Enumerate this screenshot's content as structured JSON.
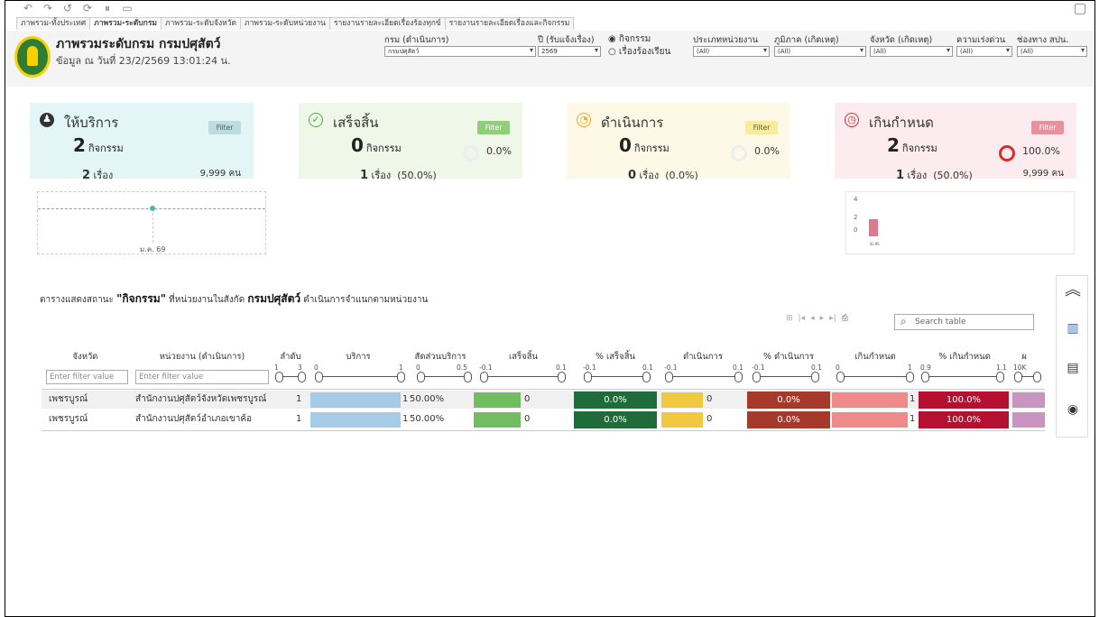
{
  "tabs": [
    "ภาพรวม-ทั้งประเทศ",
    "ภาพรวม-ระดับกรม",
    "ภาพรวม-ระดับจังหวัด",
    "ภาพรวม-ระดับหน่วยงาน",
    "รายงานรายละเอียดเรื่องร้องทุกข์",
    "รายงานรายละเอียดเรื่องและกิจกรรม"
  ],
  "header": {
    "title": "ภาพรวมระดับกรม กรมปศุสัตว์",
    "subtitle": "ข้อมูล ณ วันที่ 23/2/2569 13:01:24 น."
  },
  "filters": {
    "dept": {
      "label": "กรม (ดำเนินการ)",
      "value": "กรมปศุสัตว์"
    },
    "year": {
      "label": "ปี (รับแจ้งเรื่อง)",
      "value": "2569"
    },
    "radio1": "กิจกรรม",
    "radio2": "เรื่องร้องเรียน",
    "agency_type": {
      "label": "ประเภทหน่วยงาน",
      "value": "(All)"
    },
    "region": {
      "label": "ภูมิภาค (เกิดเหตุ)",
      "value": "(All)"
    },
    "province": {
      "label": "จังหวัด (เกิดเหตุ)",
      "value": "(All)"
    },
    "urgency": {
      "label": "ความเร่งด่วน",
      "value": "(All)"
    },
    "channel": {
      "label": "ช่องทาง สปน.",
      "value": "(All)"
    }
  },
  "cards": {
    "service": {
      "title": "ให้บริการ",
      "filter": "Filter",
      "big": "2",
      "unit": "กิจกรรม",
      "sub_num": "2",
      "sub_unit": "เรื่อง",
      "right": "9,999 คน",
      "color": "#e3f5f6",
      "filter_color": "#b9dde0"
    },
    "done": {
      "title": "เสร็จสิ้น",
      "filter": "Filter",
      "big": "0",
      "unit": "กิจกรรม",
      "pct": "0.0%",
      "sub_num": "1",
      "sub_unit": "เรื่อง",
      "sub_pct": "(50.0%)",
      "color": "#eef7e8",
      "filter_color": "#8fcf79"
    },
    "progress": {
      "title": "ดำเนินการ",
      "filter": "Filter",
      "big": "0",
      "unit": "กิจกรรม",
      "pct": "0.0%",
      "sub_num": "0",
      "sub_unit": "เรื่อง",
      "sub_pct": "(0.0%)",
      "color": "#fdf9e6",
      "filter_color": "#f7ec9d"
    },
    "overdue": {
      "title": "เกินกำหนด",
      "filter": "Filter",
      "big": "2",
      "unit": "กิจกรรม",
      "pct": "100.0%",
      "sub_num": "1",
      "sub_unit": "เรื่อง",
      "sub_pct": "(50.0%)",
      "right": "9,999 คน",
      "color": "#fcecef",
      "filter_color": "#e8919e"
    }
  },
  "sparkline": {
    "label": "ม.ค. 69"
  },
  "mini_chart": {
    "ticks": [
      "4",
      "2",
      "0"
    ],
    "label": "ม.ค."
  },
  "table": {
    "title_prefix": "ตารางแสดงสถานะ ",
    "title_q": "\"กิจกรรม\"",
    "title_mid": " ที่หน่วยงานในสังกัด ",
    "title_dept": "กรมปศุสัตว์",
    "title_suffix": " ดำเนินการจำแนกตามหน่วยงาน",
    "search_placeholder": "Search table",
    "headers": [
      "จังหวัด",
      "หน่วยงาน (ดำเนินการ)",
      "ลำดับ",
      "บริการ",
      "สัดส่วนบริการ",
      "เสร็จสิ้น",
      "% เสร็จสิ้น",
      "ดำเนินการ",
      "% ดำเนินการ",
      "เกินกำหนด",
      "% เกินกำหนด",
      "ผ"
    ],
    "filter_placeholder": "Enter filter value",
    "ranges": {
      "rank": [
        "1",
        "3"
      ],
      "service": [
        "0",
        "1"
      ],
      "ratio": [
        "0",
        "0.5"
      ],
      "done": [
        "-0.1",
        "0.1"
      ],
      "pdone": [
        "-0.1",
        "0.1"
      ],
      "prog": [
        "-0.1",
        "0.1"
      ],
      "pprog": [
        "-0.1",
        "0.1"
      ],
      "over": [
        "0",
        "1"
      ],
      "pover": [
        "0.9",
        "1.1"
      ],
      "last": [
        "10K",
        ""
      ]
    },
    "rows": [
      {
        "province": "เพชรบูรณ์",
        "agency": "สำนักงานปศุสัตว์จังหวัดเพชรบูรณ์",
        "rank": "1",
        "service": "1",
        "ratio": "50.00%",
        "done": "0",
        "pdone": "0.0%",
        "prog": "0",
        "pprog": "0.0%",
        "over": "1",
        "pover": "100.0%"
      },
      {
        "province": "เพชรบูรณ์",
        "agency": "สำนักงานปศุสัตว์อำเภอเขาค้อ",
        "rank": "1",
        "service": "1",
        "ratio": "50.00%",
        "done": "0",
        "pdone": "0.0%",
        "prog": "0",
        "pprog": "0.0%",
        "over": "1",
        "pover": "100.0%"
      }
    ]
  },
  "colors": {
    "service_bar": "#a6cbe6",
    "done_bar": "#72bd62",
    "pdone_cell": "#1f6b3a",
    "prog_bar": "#f0c93e",
    "pprog_cell": "#a63a2a",
    "over_bar": "#f08a8a",
    "pover_cell": "#b5102f",
    "last_bar": "#c994c0"
  },
  "side_icons": [
    "collapse-up-icon",
    "bar-chart-icon",
    "map-list-icon",
    "location-icon"
  ]
}
